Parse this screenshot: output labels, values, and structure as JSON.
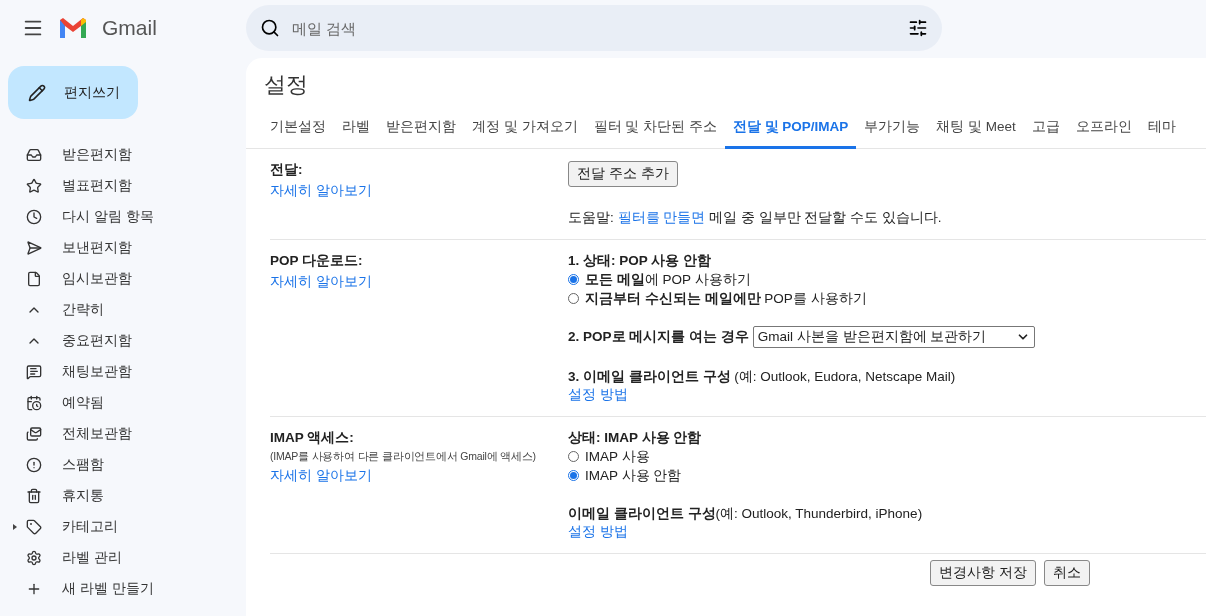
{
  "header": {
    "app_name": "Gmail",
    "search": {
      "placeholder": "메일 검색"
    }
  },
  "compose": {
    "label": "편지쓰기"
  },
  "sidebar": {
    "items": [
      {
        "label": "받은편지함"
      },
      {
        "label": "별표편지함"
      },
      {
        "label": "다시 알림 항목"
      },
      {
        "label": "보낸편지함"
      },
      {
        "label": "임시보관함"
      },
      {
        "label": "간략히"
      },
      {
        "label": "중요편지함"
      },
      {
        "label": "채팅보관함"
      },
      {
        "label": "예약됨"
      },
      {
        "label": "전체보관함"
      },
      {
        "label": "스팸함"
      },
      {
        "label": "휴지통"
      },
      {
        "label": "카테고리"
      },
      {
        "label": "라벨 관리"
      },
      {
        "label": "새 라벨 만들기"
      }
    ]
  },
  "page_title": "설정",
  "tabs": [
    {
      "label": "기본설정",
      "selected": false
    },
    {
      "label": "라벨",
      "selected": false
    },
    {
      "label": "받은편지함",
      "selected": false
    },
    {
      "label": "계정 및 가져오기",
      "selected": false
    },
    {
      "label": "필터 및 차단된 주소",
      "selected": false
    },
    {
      "label": "전달 및 POP/IMAP",
      "selected": true
    },
    {
      "label": "부가기능",
      "selected": false
    },
    {
      "label": "채팅 및 Meet",
      "selected": false
    },
    {
      "label": "고급",
      "selected": false
    },
    {
      "label": "오프라인",
      "selected": false
    },
    {
      "label": "테마",
      "selected": false
    }
  ],
  "forwarding": {
    "title": "전달:",
    "learn_more": "자세히 알아보기",
    "add_button": "전달 주소 추가",
    "help_before": "도움말: ",
    "help_link": "필터를 만들면",
    "help_after": " 메일 중 일부만 전달할 수도 있습니다."
  },
  "pop": {
    "title": "POP 다운로드:",
    "learn_more": "자세히 알아보기",
    "status": "1. 상태: POP 사용 안함",
    "options": [
      {
        "label": "**모든 메일**에 POP 사용하기",
        "selected": true
      },
      {
        "label": "**지금부터 수신되는 메일에만** POP를 사용하기",
        "selected": false
      }
    ],
    "when_label": "2. POP로 메시지를 여는 경우",
    "when_value": "Gmail 사본을 받은편지함에 보관하기",
    "client": "**3. 이메일 클라이언트 구성** (예: Outlook, Eudora, Netscape Mail)",
    "setup_link": "설정 방법"
  },
  "imap": {
    "title": "IMAP 액세스:",
    "note": "(IMAP를 사용하여 다른 클라이언트에서 Gmail에 액세스)",
    "learn_more": "자세히 알아보기",
    "status": "상태: IMAP 사용 안함",
    "options": [
      {
        "label": "IMAP 사용",
        "selected": false
      },
      {
        "label": "IMAP 사용 안함",
        "selected": true
      }
    ],
    "client": "**이메일 클라이언트 구성**(예: Outlook, Thunderbird, iPhone)",
    "setup_link": "설정 방법"
  },
  "footer_buttons": [
    "변경사항 저장",
    "취소"
  ]
}
